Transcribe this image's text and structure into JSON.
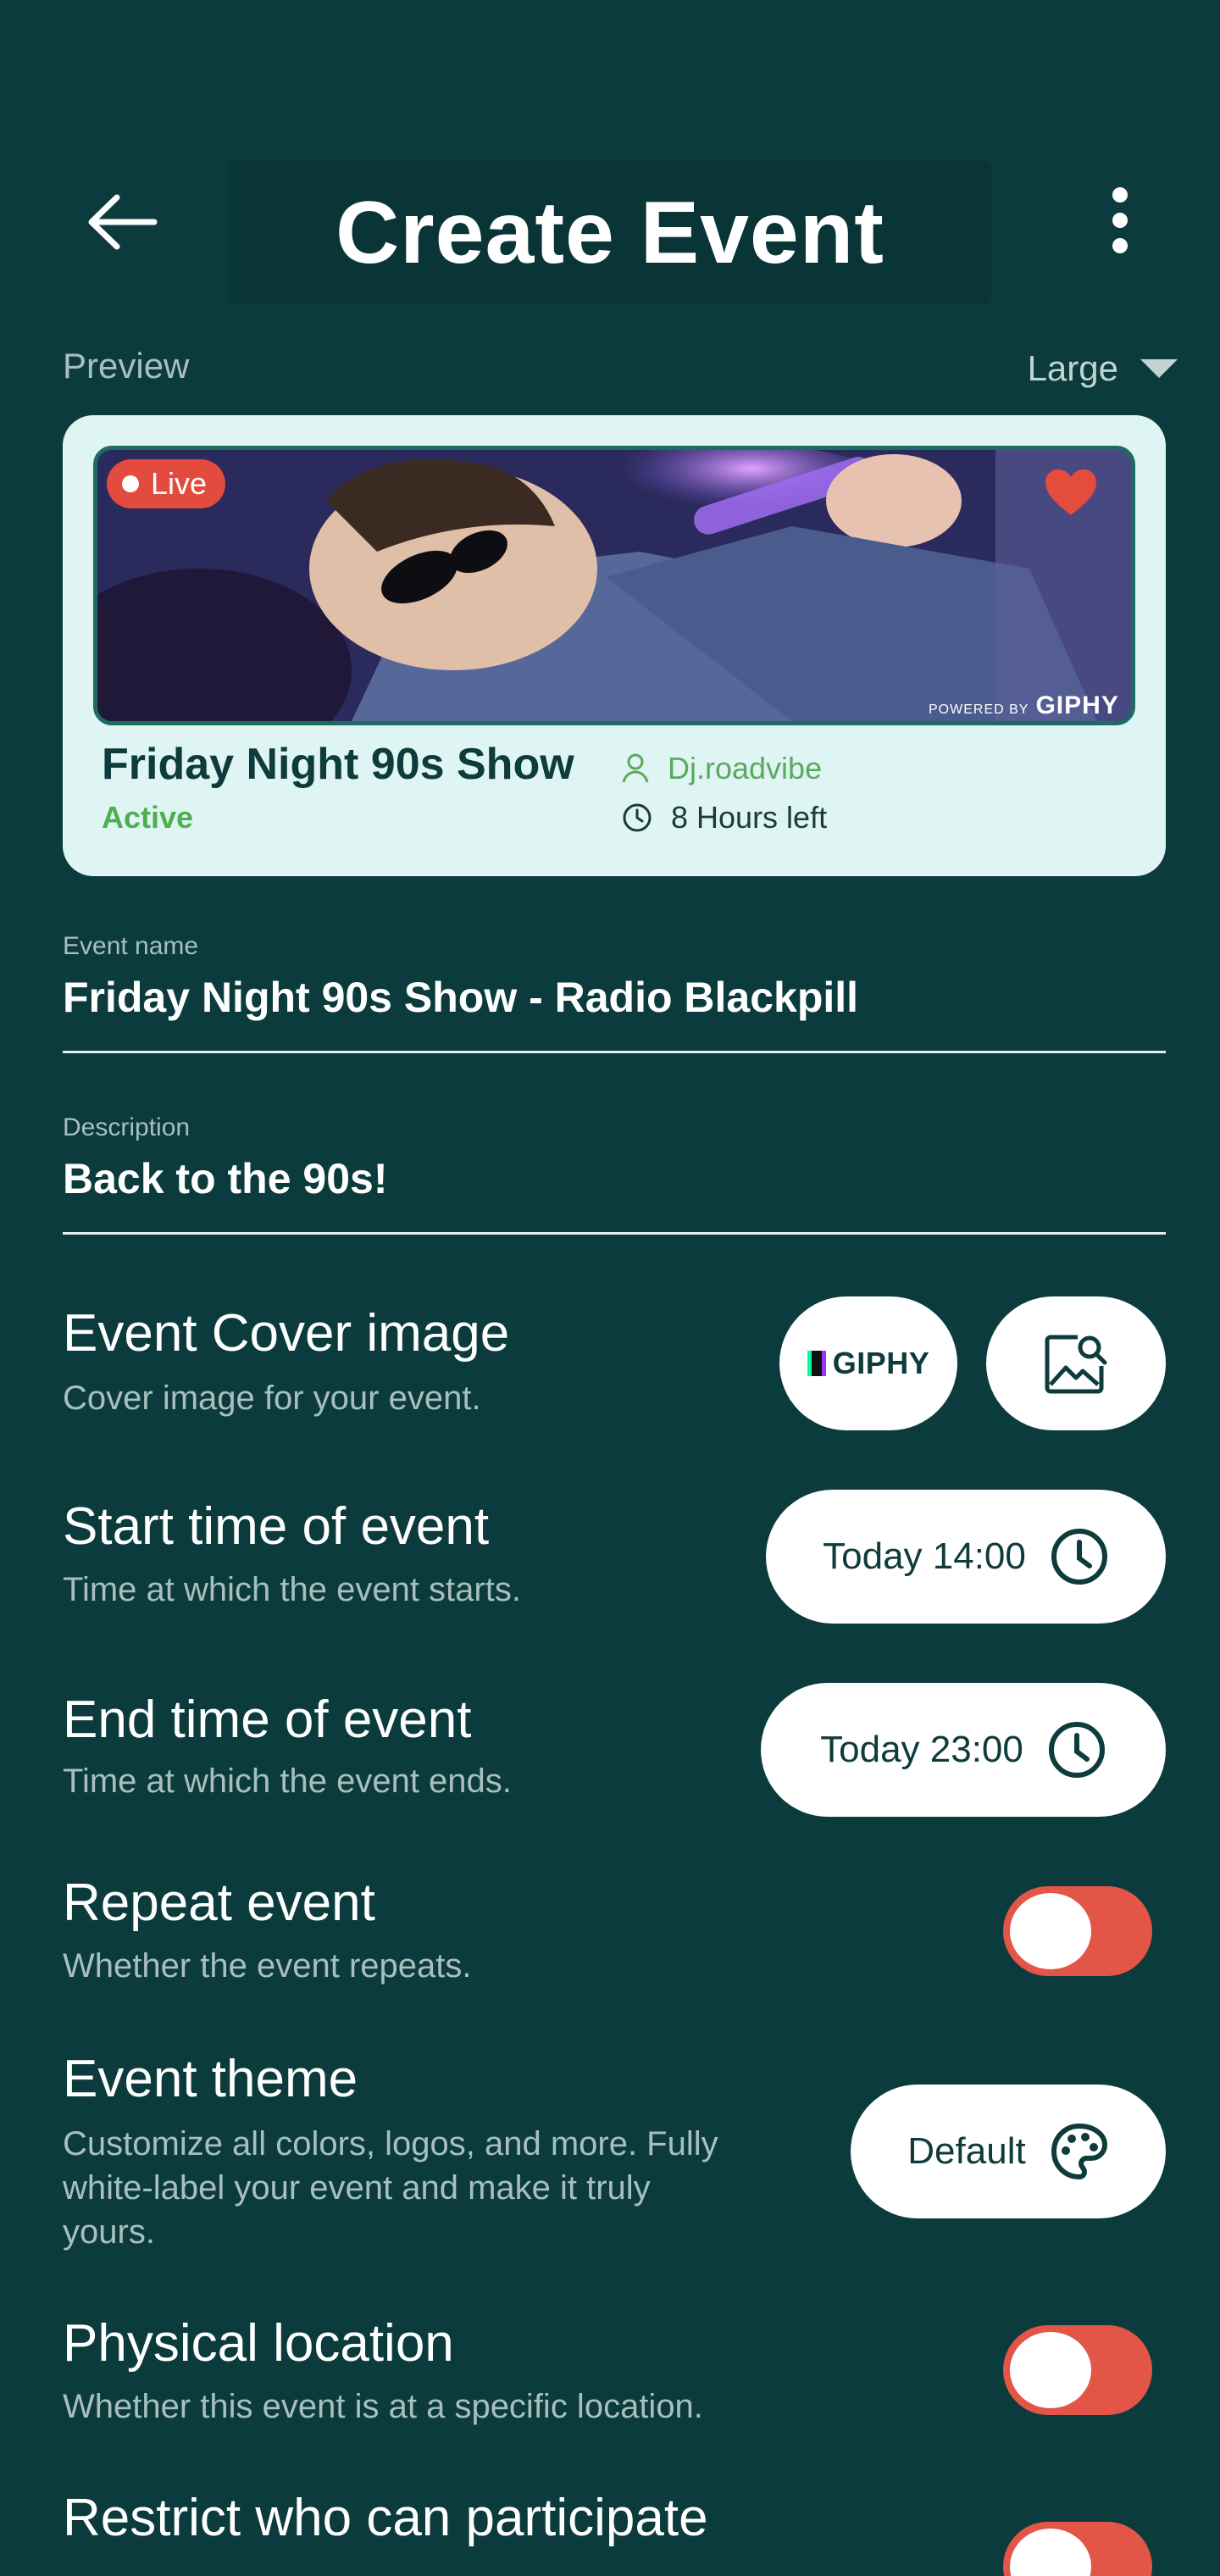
{
  "header": {
    "title": "Create Event"
  },
  "preview": {
    "label": "Preview",
    "size": "Large"
  },
  "card": {
    "live_label": "Live",
    "title": "Friday Night 90s Show",
    "status": "Active",
    "host": "Dj.roadvibe",
    "time_left": "8 Hours left",
    "powered_by": "POWERED BY",
    "giphy": "GIPHY"
  },
  "fields": {
    "event_name_label": "Event name",
    "event_name_value": "Friday Night 90s Show - Radio Blackpill",
    "description_label": "Description",
    "description_value": "Back to the 90s!"
  },
  "settings": {
    "cover": {
      "title": "Event Cover image",
      "subtitle": "Cover image for your event.",
      "giphy_label": "GIPHY"
    },
    "start": {
      "title": "Start time of event",
      "subtitle": "Time at which the event starts.",
      "value": "Today 14:00"
    },
    "end": {
      "title": "End time of event",
      "subtitle": "Time at which the event ends.",
      "value": "Today 23:00"
    },
    "repeat": {
      "title": "Repeat event",
      "subtitle": "Whether the event repeats.",
      "enabled": false
    },
    "theme": {
      "title": "Event theme",
      "subtitle_1": "Customize all colors, logos, and more. Fully",
      "subtitle_2": "white-label your event and make it truly",
      "subtitle_3": "yours.",
      "value": "Default"
    },
    "location": {
      "title": "Physical location",
      "subtitle": "Whether this event is at a specific location.",
      "enabled": false
    },
    "restrict": {
      "title": "Restrict who can participate",
      "enabled": false
    }
  },
  "colors": {
    "background": "#0b3b3c",
    "card": "#def5f3",
    "toggle_off": "#e25547",
    "active_green": "#4caf50"
  }
}
